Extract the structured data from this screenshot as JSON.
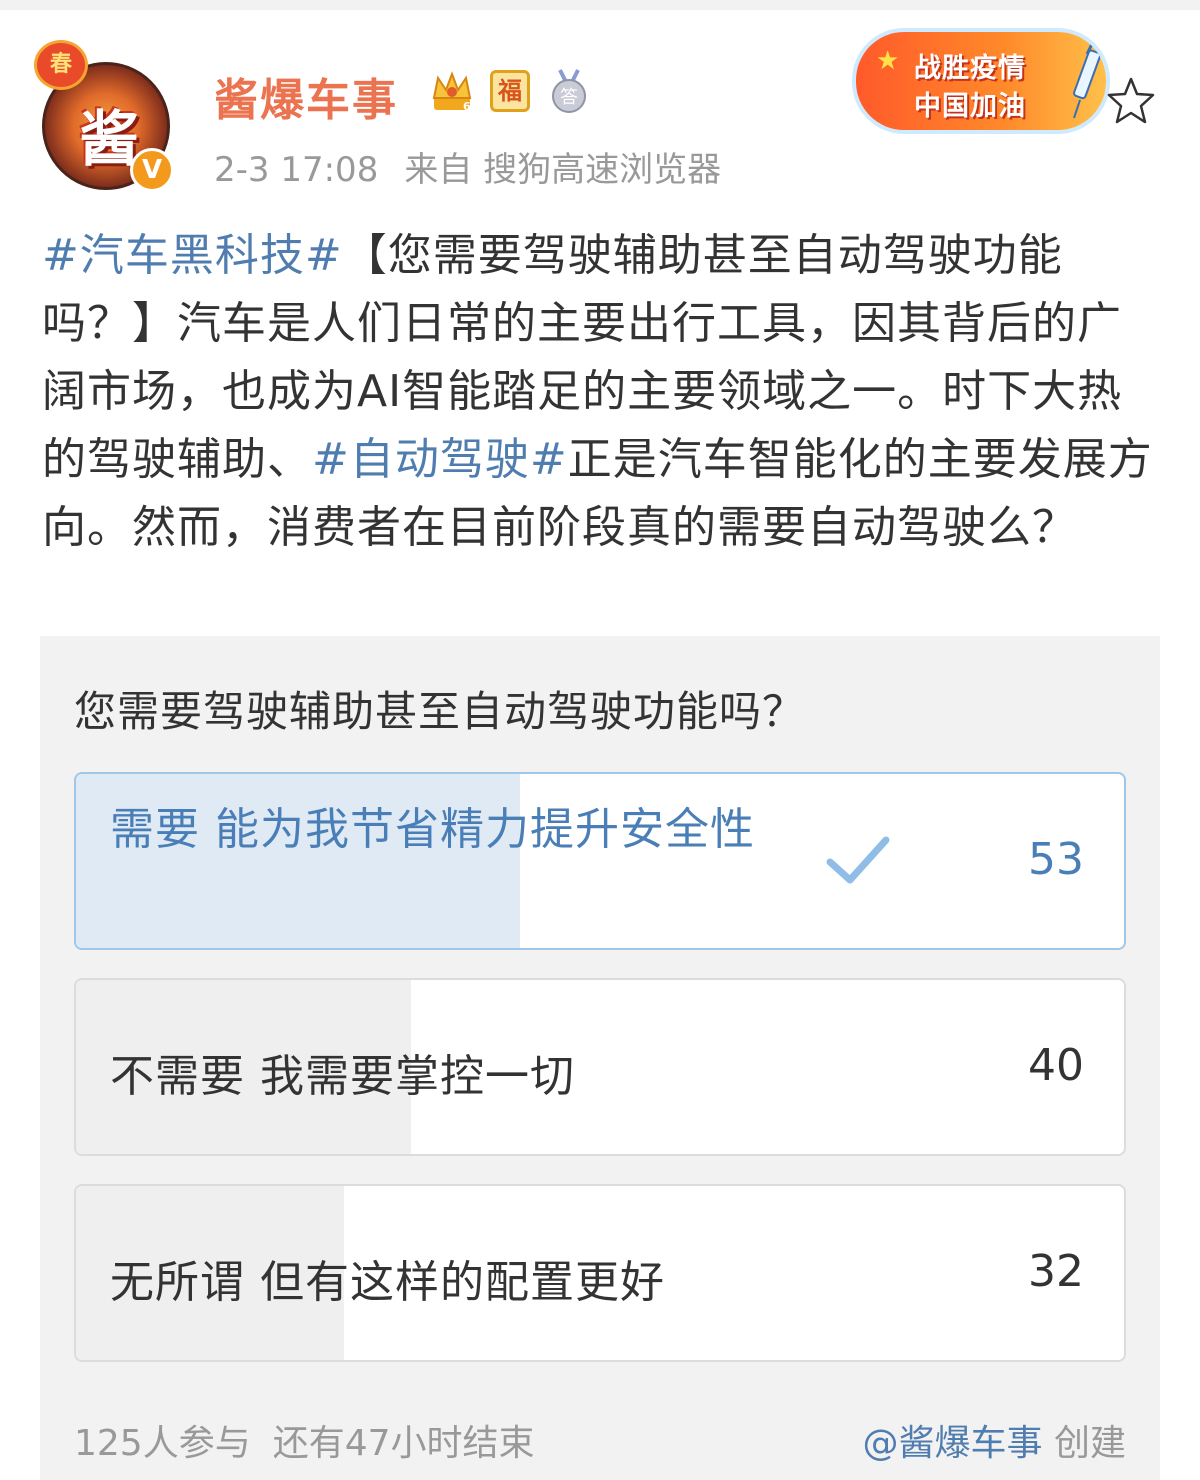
{
  "post": {
    "author": {
      "name": "酱爆车事",
      "avatar_char": "酱",
      "avatar_badge": "春",
      "verified_mark": "V"
    },
    "badges": {
      "fu": "福"
    },
    "time": "2-3 17:08",
    "source": "来自 搜狗高速浏览器",
    "campaign_banner": {
      "line1": "战胜疫情",
      "line2": "中国加油"
    },
    "text": {
      "hashtag1": "#汽车黑科技#",
      "part1": "【您需要驾驶辅助甚至自动驾驶功能吗？】汽车是人们日常的主要出行工具，因其背后的广阔市场，也成为AI智能踏足的主要领域之一。时下大热的驾驶辅助、",
      "hashtag2": "#自动驾驶#",
      "part2": "正是汽车智能化的主要发展方向。然而，消费者在目前阶段真的需要自动驾驶么？"
    }
  },
  "poll": {
    "question": "您需要驾驶辅助甚至自动驾驶功能吗？",
    "options": [
      {
        "label": "需要 能为我节省精力提升安全性",
        "count": "53",
        "selected": true,
        "fill_fraction": 0.424
      },
      {
        "label": "不需要 我需要掌控一切",
        "count": "40",
        "selected": false,
        "fill_fraction": 0.32
      },
      {
        "label": "无所谓 但有这样的配置更好",
        "count": "32",
        "selected": false,
        "fill_fraction": 0.256
      }
    ],
    "participants": "125人参与",
    "remaining": "还有47小时结束",
    "creator": "@酱爆车事",
    "creator_suffix": " 创建"
  },
  "colors": {
    "username": "#eb7350",
    "link": "#507daf",
    "selected_text": "#4a7eb6",
    "selected_fill": "#e0eaf5",
    "fill": "#efefef",
    "muted": "#999999"
  },
  "icons": [
    "crown-icon",
    "fu-badge-icon",
    "medal-icon",
    "check-icon",
    "star-outline-icon",
    "syringe-icon"
  ]
}
